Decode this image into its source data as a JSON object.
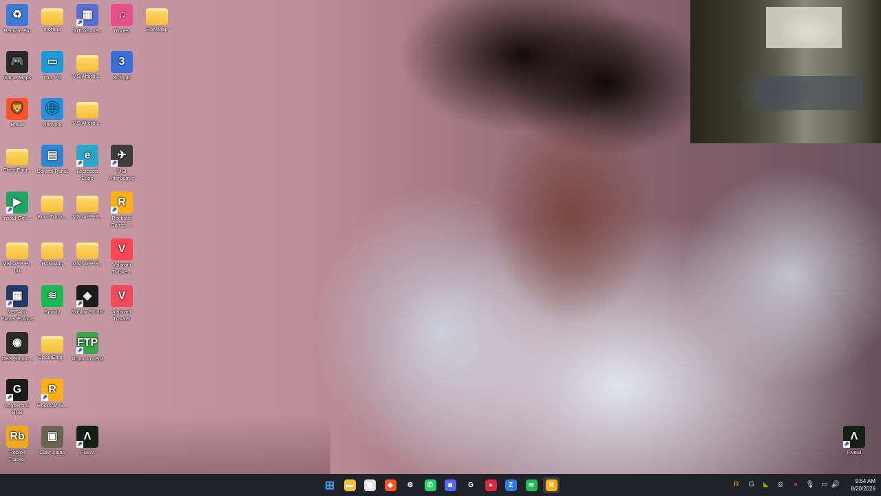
{
  "desktop": {
    "icons": [
      {
        "id": "recycle-bin",
        "label": "Recycle Bin",
        "icon": "recycle-bin-icon",
        "color": "#3d7ad6",
        "glyph": "♻"
      },
      {
        "id": "morfina",
        "label": "morfina",
        "icon": "folder-icon",
        "color": "#f4bf3a",
        "glyph": ""
      },
      {
        "id": "3utools-v9",
        "label": "3uTools_v9...",
        "icon": "package-icon",
        "color": "#5a6fd6",
        "glyph": "▦"
      },
      {
        "id": "itunes",
        "label": "iTunes",
        "icon": "itunes-icon",
        "color": "#e94f8a",
        "glyph": "♫"
      },
      {
        "id": "rammap-1",
        "label": "RAMMap",
        "icon": "folder-icon",
        "color": "#f4bf3a",
        "glyph": ""
      },
      {
        "id": "game-maps",
        "label": "Game Maps",
        "icon": "gamepad-icon",
        "color": "#2a2a2a",
        "glyph": "🎮"
      },
      {
        "id": "this-pc",
        "label": "This PC",
        "icon": "monitor-icon",
        "color": "#1e9bd6",
        "glyph": "▭"
      },
      {
        "id": "msiafterbu-1",
        "label": "MSIAfterbu...",
        "icon": "folder-icon",
        "color": "#f4bf3a",
        "glyph": ""
      },
      {
        "id": "3utools",
        "label": "3uTools",
        "icon": "3utools-icon",
        "color": "#3a6fd8",
        "glyph": "3"
      },
      {
        "id": "brave",
        "label": "Brave",
        "icon": "brave-lion-icon",
        "color": "#fb542b",
        "glyph": "🦁"
      },
      {
        "id": "network",
        "label": "Network",
        "icon": "network-globe-icon",
        "color": "#2b8ed6",
        "glyph": "🌐"
      },
      {
        "id": "msiafterbu-2",
        "label": "MSIAfterbu...",
        "icon": "folder-icon",
        "color": "#f4bf3a",
        "glyph": ""
      },
      {
        "id": "cheatengi-1",
        "label": "CheatEngi...",
        "icon": "folder-icon",
        "color": "#f4bf3a",
        "glyph": ""
      },
      {
        "id": "control-panel",
        "label": "Control Panel",
        "icon": "control-panel-icon",
        "color": "#2f86d0",
        "glyph": "▤"
      },
      {
        "id": "edge",
        "label": "Microsoft Edge",
        "icon": "edge-icon",
        "color": "#2aa6c9",
        "glyph": "e"
      },
      {
        "id": "msi-afterburner",
        "label": "MSI Afterburner",
        "icon": "afterburner-icon",
        "color": "#3d3d3d",
        "glyph": "✈"
      },
      {
        "id": "install-goo",
        "label": "Install-Goo...",
        "icon": "google-play-icon",
        "color": "#1fa463",
        "glyph": "▶"
      },
      {
        "id": "euro-truck",
        "label": "Euro.Truck...",
        "icon": "folder-icon",
        "color": "#f4bf3a",
        "glyph": ""
      },
      {
        "id": "msi-app-p-1",
        "label": "MSI-APP-P...",
        "icon": "folder-icon",
        "color": "#f4bf3a",
        "glyph": ""
      },
      {
        "id": "rockstar-games",
        "label": "Rockstar Games ...",
        "icon": "rockstar-icon",
        "color": "#fcaf17",
        "glyph": "R"
      },
      {
        "id": "msi-app-p-2",
        "label": "MSI-APP-P... (1)",
        "icon": "folder-icon",
        "color": "#f4bf3a",
        "glyph": ""
      },
      {
        "id": "rammap-2",
        "label": "RAMMap",
        "icon": "folder-icon",
        "color": "#f4bf3a",
        "glyph": ""
      },
      {
        "id": "msi-app-p-3",
        "label": "MSI-APP-P...",
        "icon": "folder-icon",
        "color": "#f4bf3a",
        "glyph": ""
      },
      {
        "id": "valorant-tracke",
        "label": "Valorant Tracke...",
        "icon": "valorant-icon",
        "color": "#ff4655",
        "glyph": "V"
      },
      {
        "id": "msi-app-player",
        "label": "MSI App Player Engine",
        "icon": "app-player-icon",
        "color": "#243a6a",
        "glyph": "▦"
      },
      {
        "id": "spotify",
        "label": "Spotify",
        "icon": "spotify-icon",
        "color": "#1db954",
        "glyph": "≋"
      },
      {
        "id": "roblox-studio",
        "label": "Roblox Studio",
        "icon": "roblox-studio-icon",
        "color": "#1b1b1b",
        "glyph": "◈"
      },
      {
        "id": "valorant-tracker",
        "label": "Valorant Tracker",
        "icon": "valorant-tracker-icon",
        "color": "#f04a5d",
        "glyph": "V"
      },
      {
        "id": "obs-studio",
        "label": "OBS-Studio...",
        "icon": "obs-icon",
        "color": "#2b2b2b",
        "glyph": "◉"
      },
      {
        "id": "cheatengi-2",
        "label": "CheatEngi...",
        "icon": "folder-icon",
        "color": "#f4bf3a",
        "glyph": ""
      },
      {
        "id": "ftp-games",
        "label": "Игры по сети",
        "icon": "ftp-icon",
        "color": "#3ea34a",
        "glyph": "FTP"
      },
      {
        "id": "logitech-ghub",
        "label": "Logitech G HUB",
        "icon": "logitech-g-icon",
        "color": "#1a1a1a",
        "glyph": "G"
      },
      {
        "id": "rockstar-g",
        "label": "Rockstar-G...",
        "icon": "rockstar-icon",
        "color": "#fcaf17",
        "glyph": "R"
      },
      {
        "id": "roblox-tracker",
        "label": "Roblox Tracker",
        "icon": "roblox-tracker-icon",
        "color": "#f2a81d",
        "glyph": "Rb"
      },
      {
        "id": "site-xatab",
        "label": "Сайт xatab",
        "icon": "xatab-icon",
        "color": "#6b6450",
        "glyph": "▣"
      },
      {
        "id": "fivem-1",
        "label": "FiveM",
        "icon": "fivem-icon",
        "color": "#152015",
        "glyph": "Λ"
      },
      {
        "id": "fivem-2",
        "label": "FiveM",
        "icon": "fivem-icon",
        "color": "#152015",
        "glyph": "Λ"
      }
    ]
  },
  "taskbar": {
    "apps": [
      {
        "id": "start",
        "icon": "windows-start-icon",
        "color": "#3ea8f5",
        "glyph": "⊞"
      },
      {
        "id": "explorer",
        "icon": "file-explorer-icon",
        "color": "#f4bf3a",
        "glyph": "▬"
      },
      {
        "id": "store",
        "icon": "store-icon",
        "color": "#e0e0e0",
        "glyph": "▦"
      },
      {
        "id": "brave",
        "icon": "brave-lion-icon",
        "color": "#fb542b",
        "glyph": "◆"
      },
      {
        "id": "settings",
        "icon": "gear-icon",
        "color": "#9aa0a8",
        "glyph": "⚙"
      },
      {
        "id": "whatsapp",
        "icon": "whatsapp-icon",
        "color": "#25d366",
        "glyph": "✆"
      },
      {
        "id": "discord",
        "icon": "discord-icon",
        "color": "#5865f2",
        "glyph": "◙"
      },
      {
        "id": "logitech",
        "icon": "logitech-g-icon",
        "color": "#1f2128",
        "glyph": "G"
      },
      {
        "id": "red-app",
        "icon": "red-app-icon",
        "color": "#e2263a",
        "glyph": "●"
      },
      {
        "id": "3utools",
        "icon": "3utools-icon",
        "color": "#2f7be5",
        "glyph": "Z"
      },
      {
        "id": "spotify",
        "icon": "spotify-icon",
        "color": "#1db954",
        "glyph": "≋"
      },
      {
        "id": "rockstar",
        "icon": "rockstar-icon",
        "color": "#fcaf17",
        "glyph": "R"
      }
    ],
    "tray": [
      {
        "id": "tray-rockstar",
        "icon": "rockstar-tray-icon",
        "glyph": "R",
        "color": "#fcaf17"
      },
      {
        "id": "tray-logitech",
        "icon": "logitech-tray-icon",
        "glyph": "G",
        "color": "#e8e8e8"
      },
      {
        "id": "tray-nvidia",
        "icon": "nvidia-icon",
        "glyph": "◣",
        "color": "#76b900"
      },
      {
        "id": "tray-steam",
        "icon": "steam-icon",
        "glyph": "◎",
        "color": "#e8e8e8"
      },
      {
        "id": "tray-red",
        "icon": "red-app-tray-icon",
        "glyph": "●",
        "color": "#e2263a"
      },
      {
        "id": "tray-mic",
        "icon": "microphone-icon",
        "glyph": "🎙",
        "color": "#e8e8e8"
      },
      {
        "id": "tray-display",
        "icon": "display-icon",
        "glyph": "▭",
        "color": "#e8e8e8"
      },
      {
        "id": "tray-volume",
        "icon": "volume-icon",
        "glyph": "🔊",
        "color": "#e8e8e8"
      }
    ],
    "clock": {
      "time": "9:54 AM",
      "date": "8/20/2026"
    }
  }
}
